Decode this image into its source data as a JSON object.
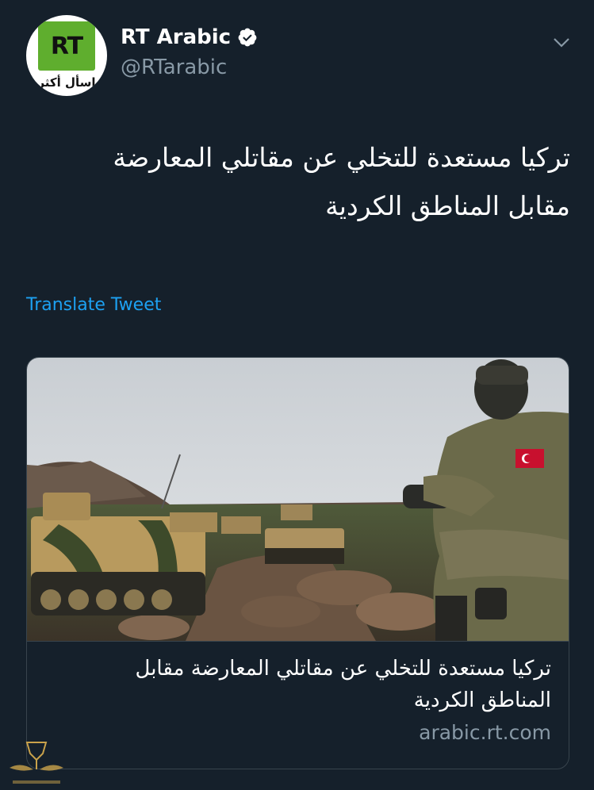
{
  "account": {
    "display_name": "RT Arabic",
    "handle": "@RTarabic",
    "avatar_logo": "RT",
    "avatar_tagline": "اسأل أكثر",
    "verified_icon": "verified-badge-icon"
  },
  "tweet": {
    "text_line_1": "تركيا مستعدة للتخلي عن مقاتلي المعارضة",
    "text_line_2": "مقابل المناطق الكردية",
    "translate_label": "Translate Tweet"
  },
  "card": {
    "title_line_1": "تركيا مستعدة للتخلي عن مقاتلي المعارضة مقابل",
    "title_line_2": "المناطق الكردية",
    "domain": "arabic.rt.com",
    "image_icon": "soldier-armored-vehicles-photo"
  },
  "colors": {
    "background": "#15202b",
    "link": "#1da1f2",
    "secondary_text": "#8899a6",
    "border": "#38444d",
    "rt_green": "#5fae2e"
  }
}
